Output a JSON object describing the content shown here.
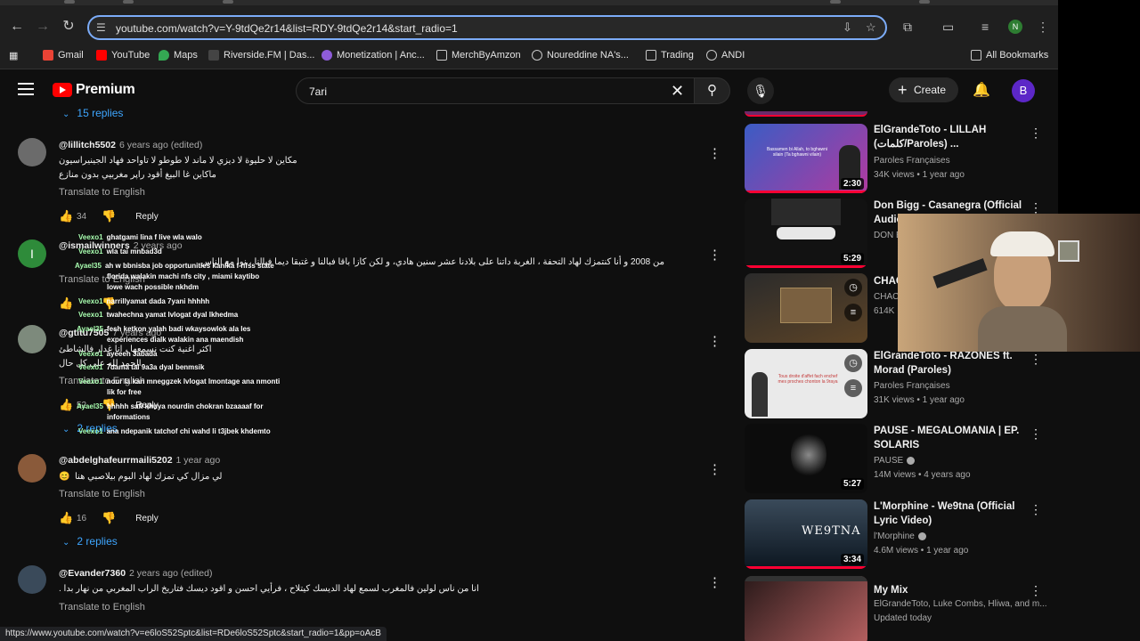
{
  "browser": {
    "url": "youtube.com/watch?v=Y-9tdQe2r14&list=RDY-9tdQe2r14&start_radio=1",
    "profile_initial": "N",
    "bookmarks": [
      {
        "label": "Gmail",
        "color": "#ea4335"
      },
      {
        "label": "YouTube",
        "color": "#ff0000"
      },
      {
        "label": "Maps",
        "color": "#34a853"
      },
      {
        "label": "Riverside.FM | Das...",
        "color": "#444444"
      },
      {
        "label": "Monetization | Anc...",
        "color": "#8e5cd9"
      },
      {
        "label": "MerchByAmzon",
        "color": "folder"
      },
      {
        "label": "Noureddine NA's...",
        "color": "#888888"
      },
      {
        "label": "Trading",
        "color": "folder"
      },
      {
        "label": "ANDI",
        "color": "#888888"
      }
    ],
    "all_bookmarks": "All Bookmarks",
    "status_url": "https://www.youtube.com/watch?v=e6loS52Sptc&list=RDe6loS52Sptc&start_radio=1&pp=oAcB"
  },
  "header": {
    "brand": "Premium",
    "search_value": "7ari",
    "create_label": "Create",
    "avatar_initial": "B"
  },
  "comments": {
    "top_replies": "15 replies",
    "translate_label": "Translate to English",
    "reply_label": "Reply",
    "items": [
      {
        "user": "@lillitch5502",
        "time": "6 years ago (edited)",
        "line1": "مكاين لا حليوة لا ديزي لا ماند لا طوطو لا تاواحد فهاد الجينيراسيون",
        "line2": "ماكاين غا البيغ أقود راپر مغربيي بدون منازع",
        "likes": "34"
      },
      {
        "user": "@ismailwinners",
        "time": "2 years ago",
        "line1": "من 2008 و أنا كنتمزك لهاد التحفة ، الغربة داتنا على بلادنا عشر سنين هادي، و لكن كازا باقا فبالنا و غتبقا ديما فبالنا ، نوا مع الناس",
        "likes": ""
      },
      {
        "user": "@gtitu7505",
        "time": "7 years ago",
        "line1": "اكثر اغنية كنت نسمعها ، انا غدار فالشاطئ",
        "line2": "الحمد لله على كل حال",
        "likes": "52"
      },
      {
        "user": "@abdelghafeurrmaili5202",
        "time": "1 year ago",
        "line1": "لي مزال كي تمزك لهاد البوم بيلاصبي هنا",
        "likes": "16",
        "replies": "2 replies"
      },
      {
        "user": "@Evander7360",
        "time": "2 years ago (edited)",
        "line1": "انا من ناس لولين فالمغرب لسمع لهاد الديسك كيتلاح ، فرأيي احسن و اقود ديسك فتاريخ الراب المغربي من نهار بدا ."
      }
    ],
    "collapse_label": "2 replies"
  },
  "chat_overlay": [
    {
      "user": "Veexo1",
      "msg": "ghatgami lina f live wla walo"
    },
    {
      "user": "Veexo1",
      "msg": "wla tai mnbad3d"
    },
    {
      "user": "Ayael35",
      "msg": "ah w bbnisba job opportunities kanlka f nfss state"
    },
    {
      "user": "",
      "msg": "florida walakin machi nfs city , miami kaytibo"
    },
    {
      "user": "",
      "msg": "lowe wach possible nkhdm"
    },
    {
      "user": "Veexo1",
      "msg": "narrillyamat dada 7yani hhhhh"
    },
    {
      "user": "Veexo1",
      "msg": "twahechna yamat lvlogat dyal lkhedma"
    },
    {
      "user": "Ayael35",
      "msg": "fesh ketkon yalah badi wkaysowlok ala les"
    },
    {
      "user": "",
      "msg": "experiences dialk walakin ana maendish"
    },
    {
      "user": "Veexo1",
      "msg": "ayeeeh 3abada"
    },
    {
      "user": "Veexo1",
      "msg": "7dama tal 9a3a dyal benmsik"
    },
    {
      "user": "Veexo1",
      "msg": "nour la kan mneggzek lvlogat lmontage ana nmonti"
    },
    {
      "user": "",
      "msg": "lik for free"
    },
    {
      "user": "Ayael35",
      "msg": "hhhhh safi khuya nourdin chokran bzaaaaf for"
    },
    {
      "user": "",
      "msg": "informations"
    },
    {
      "user": "Veexo1",
      "msg": "ana ndepanik tatchof chi wahd li t3jbek khdemto"
    }
  ],
  "related": [
    {
      "title": "ElGrandeToto - LILLAH (كلمات/Paroles) ...",
      "channel": "Paroles Françaises",
      "meta": "34K views • 1 year ago",
      "duration": "2:30",
      "thumb": "#2a3f8a"
    },
    {
      "title": "Don Bigg - Casanegra (Official Audio)",
      "channel": "DON BIGG",
      "meta": "",
      "duration": "5:29",
      "thumb": "#1a1a1a"
    },
    {
      "title": "CHAC...",
      "channel": "CHAC...",
      "meta": "614K",
      "duration": "",
      "thumb": "#4a3820"
    },
    {
      "title": "ElGrandeToto - RAZONES ft. Morad (Paroles)",
      "channel": "Paroles Françaises",
      "meta": "31K views • 1 year ago",
      "duration": "",
      "thumb": "#f0f0f0"
    },
    {
      "title": "PAUSE - MEGALOMANIA | EP. SOLARIS",
      "channel": "PAUSE",
      "meta": "14M views • 4 years ago",
      "duration": "5:27",
      "thumb": "#0c0c0c"
    },
    {
      "title": "L'Morphine - We9tna (Official Lyric Video)",
      "channel": "l'Morphine",
      "meta": "4.6M views • 1 year ago",
      "duration": "3:34",
      "thumb": "#1c2a3a"
    },
    {
      "title": "My Mix",
      "channel": "ElGrandeToto, Luke Combs, Hliwa, and m...",
      "meta": "Updated today",
      "duration": "",
      "thumb": "#5a2a2a"
    }
  ],
  "thumb_text": {
    "t0": "Bassamen bi Allah, to bghawni silain (Ta bghawni vilain)",
    "t3": "Tous droite d'affet fach enchef mes proches chonton la 9raya",
    "t5": "WE9TNA"
  }
}
